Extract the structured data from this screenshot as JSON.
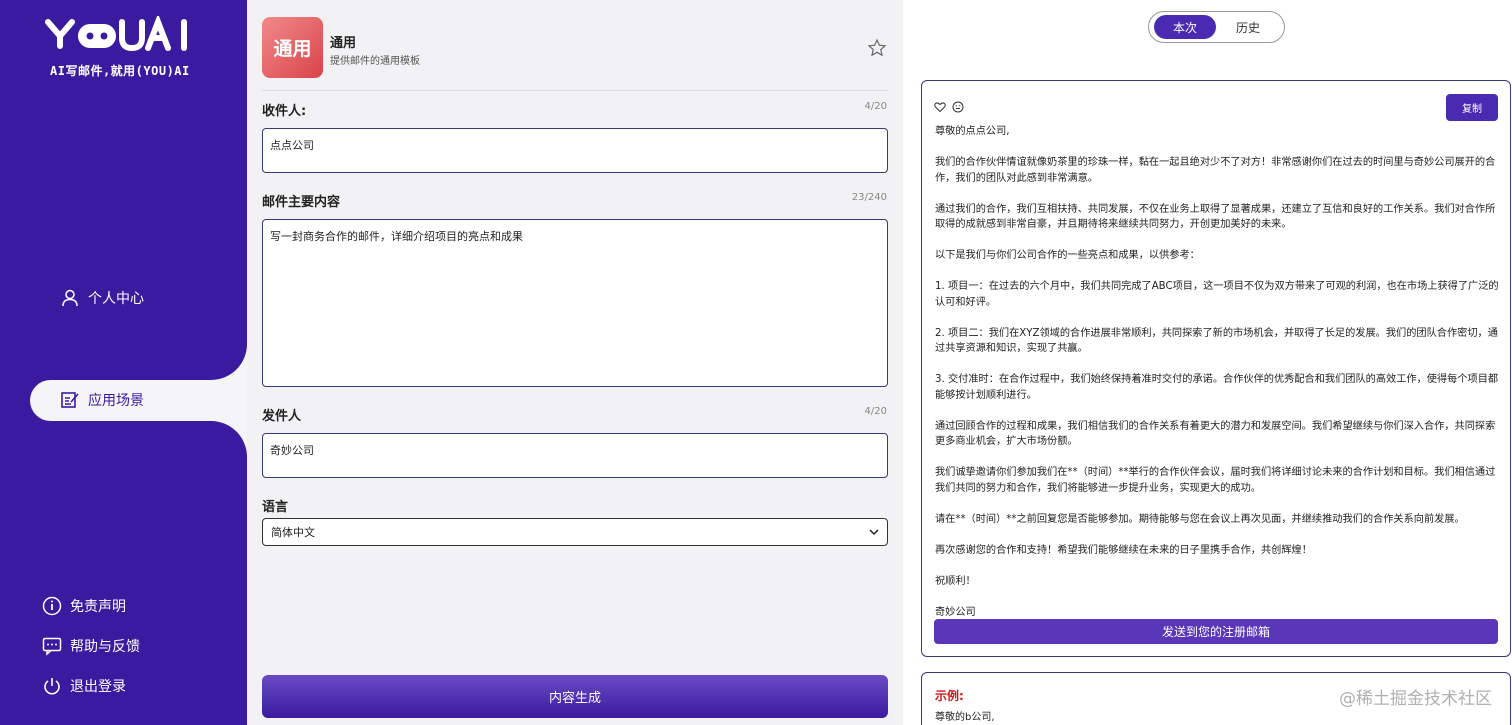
{
  "sidebar": {
    "slogan": "AI写邮件,就用(YOU)AI",
    "nav": {
      "personal": "个人中心",
      "scene": "应用场景",
      "disclaimer": "免责声明",
      "help": "帮助与反馈",
      "logout": "退出登录"
    }
  },
  "template": {
    "icon_text": "通用",
    "name": "通用",
    "description": "提供邮件的通用模板"
  },
  "form": {
    "recipient_label": "收件人:",
    "recipient_count": "4/20",
    "recipient_value": "点点公司",
    "content_label": "邮件主要内容",
    "content_count": "23/240",
    "content_value": "写一封商务合作的邮件，详细介绍项目的亮点和成果",
    "sender_label": "发件人",
    "sender_count": "4/20",
    "sender_value": "奇妙公司",
    "language_label": "语言",
    "language_value": "简体中文",
    "generate_label": "内容生成"
  },
  "result": {
    "tabs": [
      "本次",
      "历史"
    ],
    "copy_label": "复制",
    "letter": [
      "尊敬的点点公司,",
      "我们的合作伙伴情谊就像奶茶里的珍珠一样，黏在一起且绝对少不了对方！非常感谢你们在过去的时间里与奇妙公司展开的合作，我们的团队对此感到非常满意。",
      "通过我们的合作，我们互相扶持、共同发展，不仅在业务上取得了显著成果，还建立了互信和良好的工作关系。我们对合作所取得的成就感到非常自豪，并且期待将来继续共同努力，开创更加美好的未来。",
      "以下是我们与你们公司合作的一些亮点和成果，以供参考：",
      "1. 项目一：在过去的六个月中，我们共同完成了ABC项目，这一项目不仅为双方带来了可观的利润，也在市场上获得了广泛的认可和好评。",
      "2. 项目二：我们在XYZ领域的合作进展非常顺利，共同探索了新的市场机会，并取得了长足的发展。我们的团队合作密切，通过共享资源和知识，实现了共赢。",
      "3. 交付准时：在合作过程中，我们始终保持着准时交付的承诺。合作伙伴的优秀配合和我们团队的高效工作，使得每个项目都能够按计划顺利进行。",
      "通过回顾合作的过程和成果，我们相信我们的合作关系有着更大的潜力和发展空间。我们希望继续与你们深入合作，共同探索更多商业机会，扩大市场份额。",
      "我们诚挚邀请你们参加我们在**（时间）**举行的合作伙伴会议，届时我们将详细讨论未来的合作计划和目标。我们相信通过我们共同的努力和合作，我们将能够进一步提升业务，实现更大的成功。",
      "请在**（时间）**之前回复您是否能够参加。期待能够与您在会议上再次见面，并继续推动我们的合作关系向前发展。",
      "再次感谢您的合作和支持！希望我们能够继续在未来的日子里携手合作，共创辉煌！",
      "祝顺利！",
      "奇妙公司"
    ],
    "send_label": "发送到您的注册邮箱",
    "example_label": "示例:",
    "example_text": "尊敬的b公司,"
  },
  "watermark": "@稀土掘金技术社区",
  "colors": {
    "primary": "#3a1a9e",
    "accent": "#4a2ab0",
    "example_red": "#d01818"
  }
}
